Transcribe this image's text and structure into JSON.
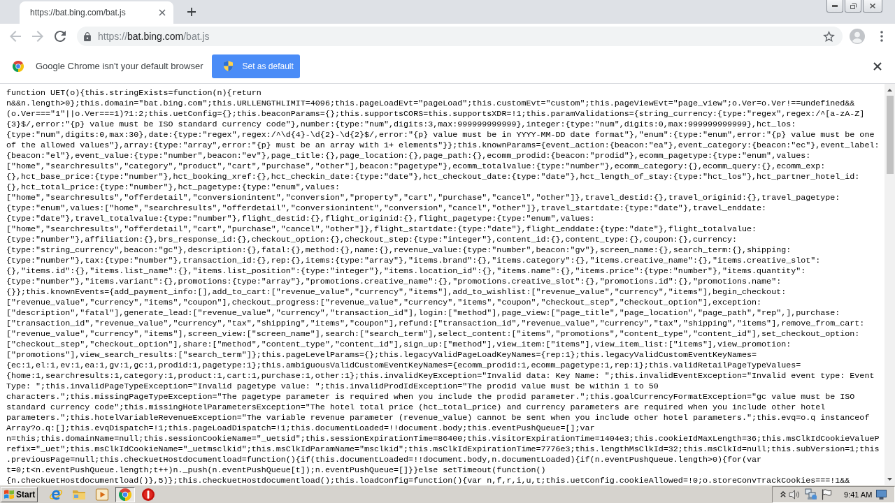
{
  "tabs": [
    {
      "title": "https://bat.bing.com/bat.js",
      "selected": true
    }
  ],
  "navigation": [
    {
      "kind": "back",
      "disabled": true
    },
    {
      "kind": "forward",
      "disabled": true
    },
    {
      "kind": "reload",
      "disabled": false
    }
  ],
  "address_bar": {
    "scheme": "https://",
    "host": "bat.bing.com",
    "path": "/bat.js"
  },
  "infobar": {
    "message": "Google Chrome isn't your default browser",
    "button": "Set as default"
  },
  "document": {
    "lines": [
      "function UET(o){this.stringExists=function(n){return",
      "n&&n.length>0};this.domain=\"bat.bing.com\";this.URLLENGTHLIMIT=4096;this.pageLoadEvt=\"pageLoad\";this.customEvt=\"custom\";this.pageViewEvt=\"page_view\";o.Ver=o.Ver!==undefined&&",
      "(o.Ver===\"1\"||o.Ver===1)?1:2;this.uetConfig={};this.beaconParams={};this.supportsCORS=this.supportsXDR=!1;this.paramValidations={string_currency:{type:\"regex\",regex:/^[a-zA-Z]",
      "{3}$/,error:\"{p} value must be ISO standard currency code\"},number:{type:\"num\",digits:3,max:999999999999},integer:{type:\"num\",digits:0,max:999999999999},hct_los:",
      "{type:\"num\",digits:0,max:30},date:{type:\"regex\",regex:/^\\d{4}-\\d{2}-\\d{2}$/,error:\"{p} value must be in YYYY-MM-DD date format\"},\"enum\":{type:\"enum\",error:\"{p} value must be one",
      "of the allowed values\"},array:{type:\"array\",error:\"{p} must be an array with 1+ elements\"}};this.knownParams={event_action:{beacon:\"ea\"},event_category:{beacon:\"ec\"},event_label:",
      "{beacon:\"el\"},event_value:{type:\"number\",beacon:\"ev\"},page_title:{},page_location:{},page_path:{},ecomm_prodid:{beacon:\"prodid\"},ecomm_pagetype:{type:\"enum\",values:",
      "[\"home\",\"searchresults\",\"category\",\"product\",\"cart\",\"purchase\",\"other\"],beacon:\"pagetype\"},ecomm_totalvalue:{type:\"number\"},ecomm_category:{},ecomm_query:{},ecomm_exp:",
      "{},hct_base_price:{type:\"number\"},hct_booking_xref:{},hct_checkin_date:{type:\"date\"},hct_checkout_date:{type:\"date\"},hct_length_of_stay:{type:\"hct_los\"},hct_partner_hotel_id:",
      "{},hct_total_price:{type:\"number\"},hct_pagetype:{type:\"enum\",values:",
      "[\"home\",\"searchresults\",\"offerdetail\",\"conversionintent\",\"conversion\",\"property\",\"cart\",\"purchase\",\"cancel\",\"other\"]},travel_destid:{},travel_originid:{},travel_pagetype:",
      "{type:\"enum\",values:[\"home\",\"searchresults\",\"offerdetail\",\"conversionintent\",\"conversion\",\"cancel\",\"other\"]},travel_startdate:{type:\"date\"},travel_enddate:",
      "{type:\"date\"},travel_totalvalue:{type:\"number\"},flight_destid:{},flight_originid:{},flight_pagetype:{type:\"enum\",values:",
      "[\"home\",\"searchresults\",\"offerdetail\",\"cart\",\"purchase\",\"cancel\",\"other\"]},flight_startdate:{type:\"date\"},flight_enddate:{type:\"date\"},flight_totalvalue:",
      "{type:\"number\"},affiliation:{},brs_response_id:{},checkout_option:{},checkout_step:{type:\"integer\"},content_id:{},content_type:{},coupon:{},currency:",
      "{type:\"string_currency\",beacon:\"gc\"},description:{},fatal:{},method:{},name:{},revenue_value:{type:\"number\",beacon:\"gv\"},screen_name:{},search_term:{},shipping:",
      "{type:\"number\"},tax:{type:\"number\"},transaction_id:{},rep:{},items:{type:\"array\"},\"items.brand\":{},\"items.category\":{},\"items.creative_name\":{},\"items.creative_slot\":",
      "{},\"items.id\":{},\"items.list_name\":{},\"items.list_position\":{type:\"integer\"},\"items.location_id\":{},\"items.name\":{},\"items.price\":{type:\"number\"},\"items.quantity\":",
      "{type:\"number\"},\"items.variant\":{},promotions:{type:\"array\"},\"promotions.creative_name\":{},\"promotions.creative_slot\":{},\"promotions.id\":{},\"promotions.name\":",
      "{}};this.knownEvents={add_payment_info:[],add_to_cart:[\"revenue_value\",\"currency\",\"items\"],add_to_wishlist:[\"revenue_value\",\"currency\",\"items\"],begin_checkout:",
      "[\"revenue_value\",\"currency\",\"items\",\"coupon\"],checkout_progress:[\"revenue_value\",\"currency\",\"items\",\"coupon\",\"checkout_step\",\"checkout_option\"],exception:",
      "[\"description\",\"fatal\"],generate_lead:[\"revenue_value\",\"currency\",\"transaction_id\"],login:[\"method\"],page_view:[\"page_title\",\"page_location\",\"page_path\",\"rep\",],purchase:",
      "[\"transaction_id\",\"revenue_value\",\"currency\",\"tax\",\"shipping\",\"items\",\"coupon\"],refund:[\"transaction_id\",\"revenue_value\",\"currency\",\"tax\",\"shipping\",\"items\"],remove_from_cart:",
      "[\"revenue_value\",\"currency\",\"items\"],screen_view:[\"screen_name\"],search:[\"search_term\"],select_content:[\"items\",\"promotions\",\"content_type\",\"content_id\"],set_checkout_option:",
      "[\"checkout_step\",\"checkout_option\"],share:[\"method\",\"content_type\",\"content_id\"],sign_up:[\"method\"],view_item:[\"items\"],view_item_list:[\"items\"],view_promotion:",
      "[\"promotions\"],view_search_results:[\"search_term\"]};this.pageLevelParams={};this.legacyValidPageLoadKeyNames={rep:1};this.legacyValidCustomEventKeyNames=",
      "{ec:1,el:1,ev:1,ea:1,gv:1,gc:1,prodid:1,pagetype:1};this.ambiguousValidCustomEventKeyNames={ecomm_prodid:1,ecomm_pagetype:1,rep:1};this.validRetailPageTypeValues=",
      "{home:1,searchresults:1,category:1,product:1,cart:1,purchase:1,other:1};this.invalidKeyException=\"Invalid data: Key Name: \";this.invalidEventException=\"Invalid event type: Event",
      "Type: \";this.invalidPageTypeException=\"Invalid pagetype value: \";this.invalidProdIdException=\"The prodid value must be within 1 to 50",
      "characters.\";this.missingPageTypeException=\"The pagetype parameter is required when you include the prodid parameter.\";this.goalCurrencyFormatException=\"gc value must be ISO",
      "standard currency code\";this.missingHotelParametersException=\"The hotel total price (hct_total_price) and currency parameters are required when you include other hotel",
      "parameters.\";this.hotelVariableRevenueException=\"The variable revenue parameter (revenue_value) cannot be sent when you include other hotel parameters.\";this.evq=o.q instanceof",
      "Array?o.q:[];this.evqDispatch=!1;this.pageLoadDispatch=!1;this.documentLoaded=!!document.body;this.eventPushQueue=[];var",
      "n=this;this.domainName=null;this.sessionCookieName=\"_uetsid\";this.sessionExpirationTime=86400;this.visitorExpirationTime=1404e3;this.cookieIdMaxLength=36;this.msClkIdCookieValueP",
      "refix=\"_uet\";this.msClkIdCookieName=\"_uetmsclkid\";this.msClkIdParamName=\"msclkid\";this.msClkIdExpirationTime=7776e3;this.lengthMsClkId=32;this.msClkId=null;this.subVersion=1;this",
      ".previousPage=null;this.checkuetHostdocumentload=function(){if(this.documentLoaded=!!document.body,n.documentLoaded){if(n.eventPushQueue.length>0){for(var",
      "t=0;t<n.eventPushQueue.length;t++)n._push(n.eventPushQueue[t]);n.eventPushQueue=[]}}else setTimeout(function()",
      "{n.checkuetHostdocumentload()},5)};this.checkuetHostdocumentload();this.loadConfig=function(){var n,f,r,i,u,t;this.uetConfig.cookieAllowed=!0;o.storeConvTrackCookies===!1&&"
    ]
  },
  "taskbar": {
    "start": "Start",
    "apps": [
      {
        "kind": "ie",
        "selected": false
      },
      {
        "kind": "folder",
        "selected": false
      },
      {
        "kind": "media",
        "selected": false
      },
      {
        "kind": "chrome",
        "selected": true
      },
      {
        "kind": "alert",
        "selected": false
      }
    ],
    "clock": "9:41 AM"
  }
}
